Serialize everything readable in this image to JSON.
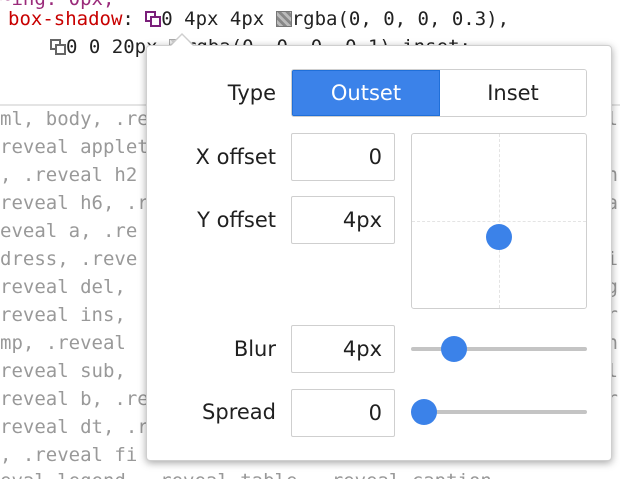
{
  "code": {
    "line0_partial": "~ing: 0px;",
    "prop": "box-shadow",
    "colon": ":",
    "shadow1_value": "0 4px 4px",
    "shadow1_color": "rgba(0, 0, 0, 0.3),",
    "shadow2_value": "0 0 20px",
    "shadow2_color": "rgba(0, 0, 0, 0.1) inset;"
  },
  "selectors": [
    "ml, body, .reveal",
    "reveal applet",
    ", .reveal h2",
    "reveal h6, .r",
    "eveal a, .re",
    "dress, .reve",
    "reveal del,",
    "reveal ins,",
    "mp, .reveal",
    "reveal sub,",
    "reveal b, .re",
    "reveal dt, .r",
    ", .reveal fi",
    "eval legend, .reveal table, .reveal caption,"
  ],
  "right_edge_chars": [
    "l",
    "n",
    "a",
    "i",
    "g",
    "r",
    "n",
    "l",
    "r"
  ],
  "editor": {
    "type_label": "Type",
    "type_options": [
      "Outset",
      "Inset"
    ],
    "type_selected": "Outset",
    "x_offset_label": "X offset",
    "x_offset_value": "0",
    "y_offset_label": "Y offset",
    "y_offset_value": "4px",
    "blur_label": "Blur",
    "blur_value": "4px",
    "blur_fraction": 0.2,
    "spread_label": "Spread",
    "spread_value": "0",
    "spread_fraction": 0.0,
    "pad_offset_fraction_x": 0.0,
    "pad_offset_fraction_y": 0.18
  },
  "colors": {
    "accent": "#3b82e9",
    "property_red": "#c80000"
  }
}
